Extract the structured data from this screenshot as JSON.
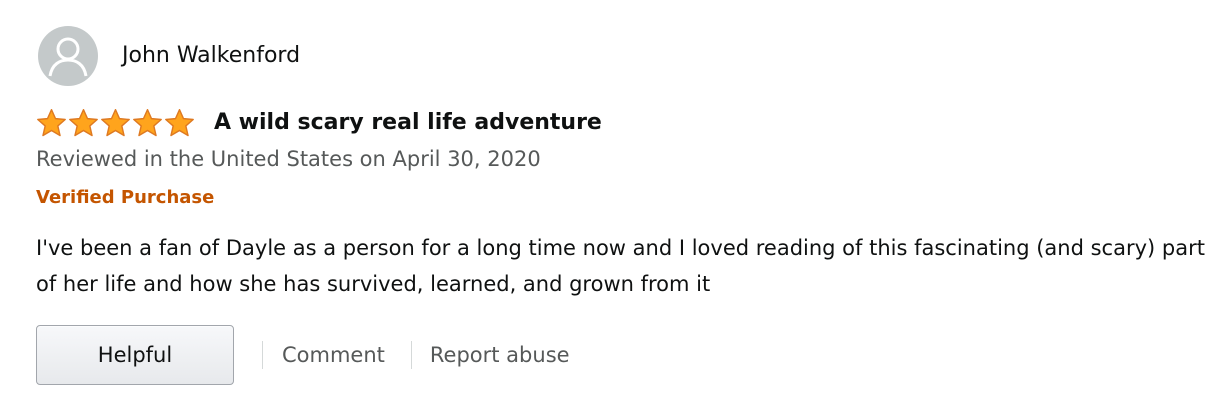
{
  "review": {
    "profile_name": "John Walkenford",
    "avatar_icon": "default-profile-icon",
    "rating": 5,
    "max_rating": 5,
    "star_color": "#ffa41c",
    "title": "A wild scary real life adventure",
    "date": "Reviewed in the United States on April 30, 2020",
    "verified_label": "Verified Purchase",
    "verified_color": "#c45500",
    "body": "I've been a fan of Dayle as a person for a long time now and I loved reading of this fascinating (and scary) part of her life and how she has survived, learned, and grown from it"
  },
  "actions": {
    "helpful_label": "Helpful",
    "comment_label": "Comment",
    "report_label": "Report abuse"
  }
}
